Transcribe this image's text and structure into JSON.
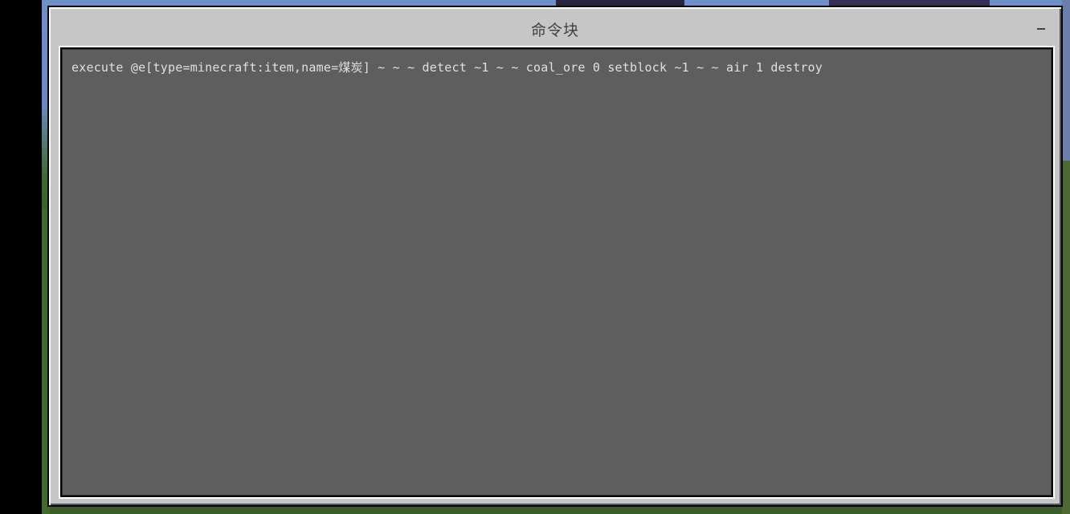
{
  "dialog": {
    "title": "命令块",
    "minimize_label": "–"
  },
  "editor": {
    "command": "execute @e[type=minecraft:item,name=煤炭] ~ ~ ~ detect ~1 ~ ~ coal_ore 0 setblock ~1 ~ ~ air 1 destroy"
  },
  "colors": {
    "dialog_bg": "#c6c6c6",
    "editor_bg": "#5e5e5e",
    "text": "#e0e0e0",
    "title_text": "#404040"
  }
}
